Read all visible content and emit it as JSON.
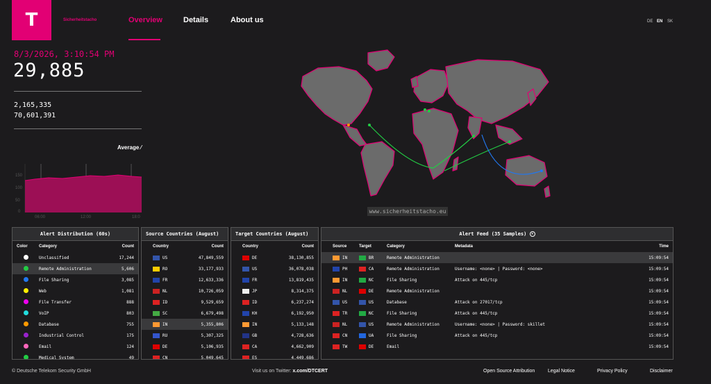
{
  "brand": {
    "logo_glyph": "T",
    "name": "Sicherheitstacho"
  },
  "nav": {
    "overview": "Overview",
    "details": "Details",
    "about": "About us"
  },
  "langs": [
    "DE",
    "EN",
    "SK"
  ],
  "stats": {
    "timestamp": "8/3/2026, 3:10:54 PM",
    "main_count": "29,885",
    "count2": "2,165,335",
    "count3": "70,601,391",
    "average_label": "Average ⁄"
  },
  "mini_chart": {
    "y_ticks": [
      "150",
      "100",
      "50",
      "0"
    ],
    "x_ticks": [
      "06:00",
      "12:00",
      "18:0"
    ]
  },
  "watermark": "www.sicherheitstacho.eu",
  "alert_distribution": {
    "title": "Alert Distribution (60s)",
    "headers": [
      "Color",
      "Category",
      "Count"
    ],
    "rows": [
      {
        "color": "#ffffff",
        "category": "Unclassified",
        "count": "17,244"
      },
      {
        "color": "#22cc44",
        "category": "Remote Administration",
        "count": "5,606"
      },
      {
        "color": "#2277ee",
        "category": "File Sharing",
        "count": "3,085"
      },
      {
        "color": "#ffee00",
        "category": "Web",
        "count": "1,081"
      },
      {
        "color": "#ee00ee",
        "category": "File Transfer",
        "count": "888"
      },
      {
        "color": "#22dddd",
        "category": "VoIP",
        "count": "803"
      },
      {
        "color": "#ff9900",
        "category": "Database",
        "count": "755"
      },
      {
        "color": "#9922cc",
        "category": "Industrial Control",
        "count": "175"
      },
      {
        "color": "#ff66bb",
        "category": "Email",
        "count": "124"
      },
      {
        "color": "#22cc44",
        "category": "Medical System",
        "count": "49"
      }
    ]
  },
  "source_countries": {
    "title": "Source Countries (August)",
    "headers": [
      "Country",
      "Count"
    ],
    "rows": [
      {
        "code": "US",
        "count": "47,849,559",
        "flag": "#3355aa"
      },
      {
        "code": "RO",
        "count": "33,177,933",
        "flag": "#ffcc00"
      },
      {
        "code": "FR",
        "count": "12,633,336",
        "flag": "#2244aa"
      },
      {
        "code": "NL",
        "count": "10,726,059",
        "flag": "#cc2222"
      },
      {
        "code": "ID",
        "count": "9,529,659",
        "flag": "#dd2222"
      },
      {
        "code": "SC",
        "count": "6,679,498",
        "flag": "#44aa44"
      },
      {
        "code": "IN",
        "count": "5,355,806",
        "flag": "#ff9933"
      },
      {
        "code": "RU",
        "count": "5,307,325",
        "flag": "#3355cc"
      },
      {
        "code": "DE",
        "count": "5,106,935",
        "flag": "#dd0000"
      },
      {
        "code": "CN",
        "count": "5,049,645",
        "flag": "#dd2222"
      }
    ]
  },
  "target_countries": {
    "title": "Target Countries (August)",
    "headers": [
      "Country",
      "Count"
    ],
    "rows": [
      {
        "code": "DE",
        "count": "38,130,855",
        "flag": "#dd0000"
      },
      {
        "code": "US",
        "count": "36,078,038",
        "flag": "#3355aa"
      },
      {
        "code": "FR",
        "count": "13,819,435",
        "flag": "#2244aa"
      },
      {
        "code": "JP",
        "count": "8,314,375",
        "flag": "#eeeeee"
      },
      {
        "code": "ID",
        "count": "6,237,274",
        "flag": "#dd2222"
      },
      {
        "code": "KH",
        "count": "6,192,950",
        "flag": "#2244aa"
      },
      {
        "code": "IN",
        "count": "5,133,148",
        "flag": "#ff9933"
      },
      {
        "code": "GB",
        "count": "4,728,636",
        "flag": "#223388"
      },
      {
        "code": "CA",
        "count": "4,662,909",
        "flag": "#dd2222"
      },
      {
        "code": "ES",
        "count": "4,449,686",
        "flag": "#dd2222"
      }
    ]
  },
  "alert_feed": {
    "title": "Alert Feed (35 Samples)",
    "headers": [
      "Source",
      "Target",
      "Category",
      "Metadata",
      "Time"
    ],
    "rows": [
      {
        "src": "IN",
        "sf": "#ff9933",
        "tgt": "BR",
        "tf": "#22aa44",
        "cat": "Remote Administration",
        "meta": "",
        "time": "15:09:54"
      },
      {
        "src": "PH",
        "sf": "#2244aa",
        "tgt": "CA",
        "tf": "#dd2222",
        "cat": "Remote Administration",
        "meta": "Username: <none> | Password: <none>",
        "time": "15:09:54"
      },
      {
        "src": "IN",
        "sf": "#ff9933",
        "tgt": "NC",
        "tf": "#22aa44",
        "cat": "File Sharing",
        "meta": "Attack on 445/tcp",
        "time": "15:09:54"
      },
      {
        "src": "NL",
        "sf": "#cc2222",
        "tgt": "DE",
        "tf": "#dd0000",
        "cat": "Remote Administration",
        "meta": "",
        "time": "15:09:54"
      },
      {
        "src": "US",
        "sf": "#3355aa",
        "tgt": "US",
        "tf": "#3355aa",
        "cat": "Database",
        "meta": "Attack on 27017/tcp",
        "time": "15:09:54"
      },
      {
        "src": "TR",
        "sf": "#dd2222",
        "tgt": "NC",
        "tf": "#22aa44",
        "cat": "File Sharing",
        "meta": "Attack on 445/tcp",
        "time": "15:09:54"
      },
      {
        "src": "NL",
        "sf": "#cc2222",
        "tgt": "US",
        "tf": "#3355aa",
        "cat": "Remote Administration",
        "meta": "Username: <none> | Password: skillet",
        "time": "15:09:54"
      },
      {
        "src": "CN",
        "sf": "#dd2222",
        "tgt": "UA",
        "tf": "#2266dd",
        "cat": "File Sharing",
        "meta": "Attack on 445/tcp",
        "time": "15:09:54"
      },
      {
        "src": "TW",
        "sf": "#dd2222",
        "tgt": "DE",
        "tf": "#dd0000",
        "cat": "Email",
        "meta": "",
        "time": "15:09:54"
      }
    ]
  },
  "footer": {
    "copyright": "© Deutsche Telekom Security GmbH",
    "twitter_prefix": "Visit us on Twitter: ",
    "twitter_handle": "x.com/DTCERT",
    "link1": "Open Source Attribution",
    "link2": "Legal Notice",
    "link3": "Privacy Policy",
    "link4": "Disclaimer"
  }
}
